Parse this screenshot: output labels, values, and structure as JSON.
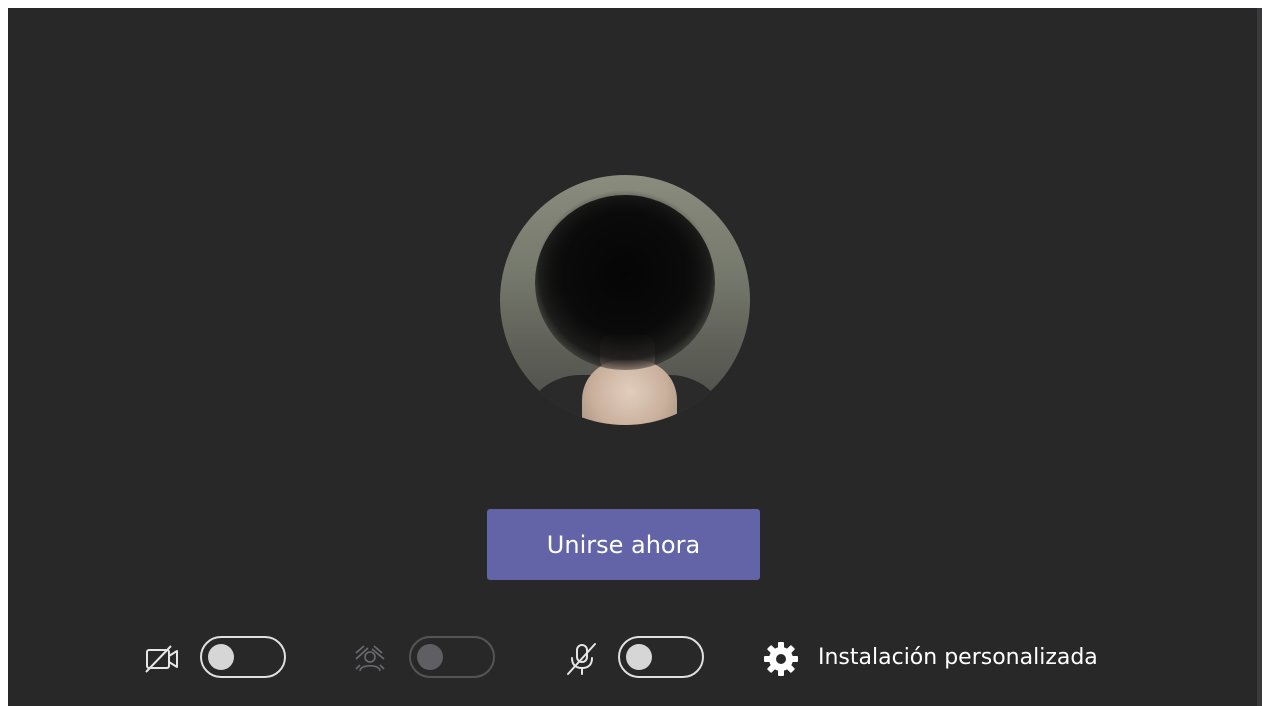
{
  "join": {
    "label": "Unirse ahora"
  },
  "controls": {
    "camera": {
      "icon": "camera-off-icon",
      "enabled": false
    },
    "background": {
      "icon": "background-blur-icon",
      "enabled": false,
      "disabled": true
    },
    "microphone": {
      "icon": "microphone-off-icon",
      "enabled": false
    },
    "settings": {
      "icon": "gear-icon",
      "label": "Instalación personalizada"
    }
  },
  "colors": {
    "background": "#292829",
    "accent": "#6264a7",
    "text": "#ffffff"
  }
}
